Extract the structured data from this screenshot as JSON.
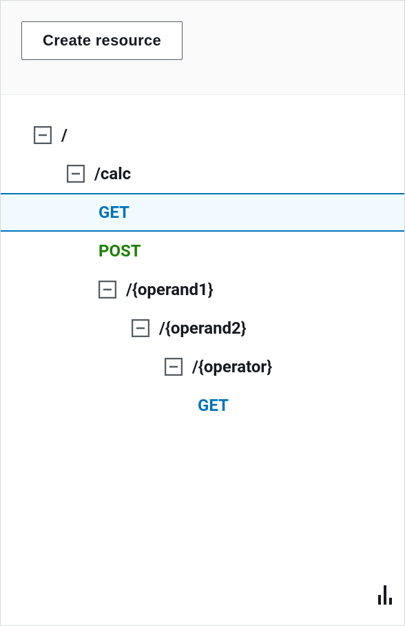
{
  "header": {
    "create_resource_label": "Create resource"
  },
  "tree": {
    "root": {
      "path": "/"
    },
    "calc": {
      "path": "/calc"
    },
    "calc_get": {
      "method": "GET"
    },
    "calc_post": {
      "method": "POST"
    },
    "operand1": {
      "path": "/{operand1}"
    },
    "operand2": {
      "path": "/{operand2}"
    },
    "operator": {
      "path": "/{operator}"
    },
    "operator_get": {
      "method": "GET"
    }
  }
}
